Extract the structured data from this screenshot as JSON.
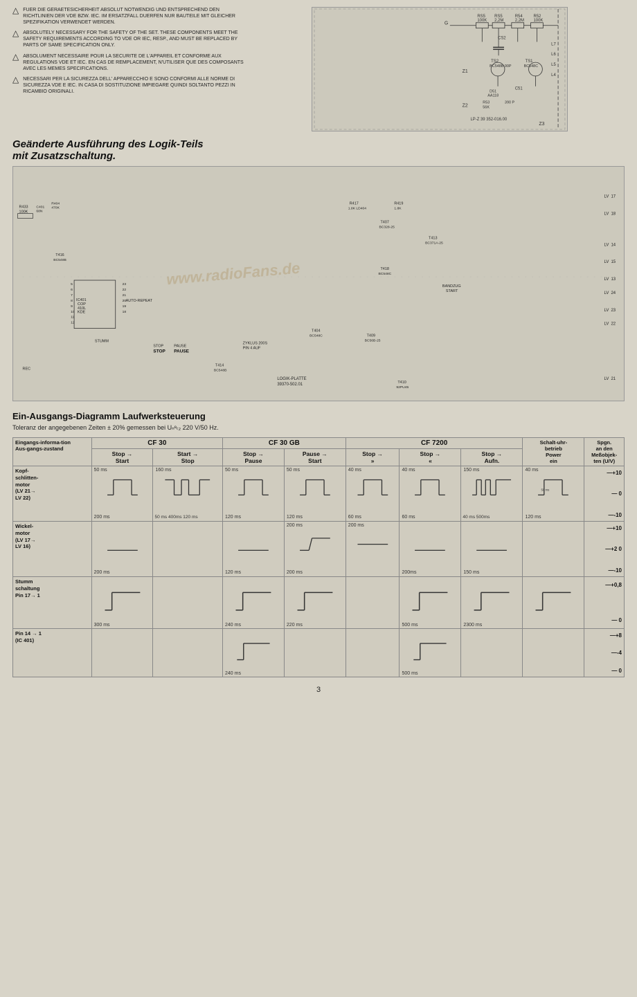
{
  "safety": {
    "items": [
      {
        "id": 1,
        "text": "FUER DIE GERAETESICHERHEIT ABSOLUT NOTWENDIG UND ENTSPRECHEND DEN RICHTLINIEN DER VDE BZW. IEC. IM ERSATZFALL DUERFEN NUR BAUTEILE MIT GLEICHER SPEZIFIKATION VERWENDET WERDEN."
      },
      {
        "id": 2,
        "text": "ABSOLUTELY NECESSARY FOR THE SAFETY OF THE SET. THESE COMPONENTS MEET THE SAFETY REQUIREMENTS ACCORDING TO VDE OR IEC, RESP., AND MUST BE REPLACED BY PARTS OF SAME SPECIFICATION ONLY."
      },
      {
        "id": 3,
        "text": "ABSOLUMENT NECESSAIRE POUR LA SECURITE DE L'APPAREIL ET CONFORME AUX REGULATIONS VDE ET IEC. EN CAS DE REMPLACEMENT, N'UTILISER QUE DES COMPOSANTS AVEC LES MEMES SPECIFICATIONS."
      },
      {
        "id": 4,
        "text": "NECESSARI PER LA SICUREZZA DELL' APPARECCHIO E SONO CONFORMI ALLE NORME DI SICUREZZA VDE E IEC. IN CASA DI SOSTITUZIONE IMPIEGARE QUINDI SOLTANTO PEZZI IN RICAMBIO ORIGINALI."
      }
    ]
  },
  "section_title": {
    "line1": "Geänderte Ausführung des Logik-Teils",
    "line2": "mit Zusatzschaltung."
  },
  "diagram_title": "Ein-Ausgangs-Diagramm Laufwerksteuerung",
  "tolerance_note": "Toleranz der angegebenen Zeiten ± 20% gemessen bei Uₙᵉₜ₂ 220 V/50 Hz.",
  "table": {
    "sections": [
      "CF 30",
      "CF 30 GB",
      "CF 7200"
    ],
    "col_headers": {
      "eingangs": "Eingangs-informa-tion",
      "ausgangs": "Aus-gangs-zustand",
      "cf30_col1_in": "Stop",
      "cf30_col1_out": "Start",
      "cf30_col2_in": "Start",
      "cf30_col2_out": "Stop",
      "cf30gb_col1_in": "Stop",
      "cf30gb_col1_out": "Pause",
      "cf30gb_col2_in": "Pause",
      "cf30gb_col2_out": "Start",
      "cf7200_col1_in": "Stop",
      "cf7200_col1_out": "»",
      "cf7200_col2_in": "Stop",
      "cf7200_col2_out": "«",
      "cf7200_col3_in": "Stop",
      "cf7200_col3_out": "Aufn.",
      "schaltuhr": "Schalt-uhr-betrieb Power ein",
      "spgn": "Spgn. an den Meßobjek-ten (U/V)"
    },
    "rows": [
      {
        "label": "Kopf-schlitten-motor (LV 21→ LV 22)",
        "cf30_c1_top": "50 ms",
        "cf30_c1_bot": "200 ms",
        "cf30_c2_top": "160 ms",
        "cf30_c2_mid1": "50 ms 400ms",
        "cf30_c2_mid2": "120 ms",
        "cf30gb_c1_top": "50 ms",
        "cf30gb_c1_bot": "120 ms",
        "cf30gb_c2_top": "50 ms",
        "cf30gb_c2_bot": "120 ms",
        "cf7200_c1_top": "40 ms",
        "cf7200_c1_bot": "60 ms",
        "cf7200_c2_top": "40 ms",
        "cf7200_c2_bot": "60 ms",
        "cf7200_c3_top": "150 ms",
        "cf7200_c3_bot1": "40 ms",
        "cf7200_c3_bot2": "500ms",
        "schaltuhr_top": "40 ms",
        "schaltuhr_mid": "50 ms",
        "schaltuhr_bot": "120 ms",
        "spgn_vals": [
          "+10",
          "0",
          "-10"
        ]
      },
      {
        "label": "Wickel-motor (LV 17→ LV 16)",
        "cf30_c1_bot": "200 ms",
        "cf30gb_c1_bot": "120 ms",
        "cf30gb_c2_top": "200 ms",
        "cf30gb_c2_bot": "200 ms",
        "cf7200_c1_top": "200 ms",
        "cf7200_c2_bot": "200ms",
        "cf7200_c3_top": "150 ms",
        "spgn_vals": [
          "+10",
          "+2 0",
          "-10"
        ]
      },
      {
        "label": "Stumm schaltung Pin 17→ 1",
        "cf30_c1_bot": "300 ms",
        "cf30gb_c1_bot": "240 ms",
        "cf30gb_c2_bot": "220 ms",
        "cf7200_c2_bot": "500 ms",
        "cf7200_c3_bot": "2300 ms",
        "spgn_vals": [
          "+0,8",
          "0"
        ]
      },
      {
        "label": "Pin 14→ 1 (IC 401)",
        "cf30gb_c1_bot": "240 ms",
        "cf7200_c2_bot": "500 ms",
        "spgn_vals": [
          "+8",
          "-4",
          "0"
        ]
      }
    ]
  },
  "page_number": "3"
}
